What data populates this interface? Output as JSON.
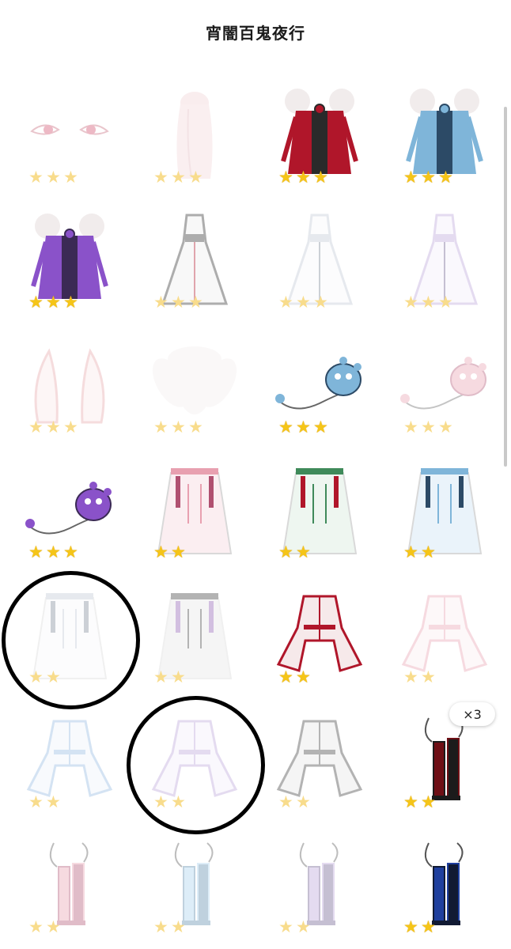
{
  "header": {
    "title": "宵闇百鬼夜行"
  },
  "items": [
    {
      "icon": "eyes-icon",
      "stars": 3,
      "owned": false
    },
    {
      "icon": "long-hair-icon",
      "stars": 3,
      "owned": false
    },
    {
      "icon": "red-kimono-hair-icon",
      "stars": 3,
      "owned": true
    },
    {
      "icon": "blue-kimono-hair-icon",
      "stars": 3,
      "owned": true
    },
    {
      "icon": "purple-kimono-hair-icon",
      "stars": 3,
      "owned": true
    },
    {
      "icon": "black-dress-icon",
      "stars": 3,
      "owned": false
    },
    {
      "icon": "white-blue-dress-icon",
      "stars": 3,
      "owned": false
    },
    {
      "icon": "lilac-dress-icon",
      "stars": 3,
      "owned": false
    },
    {
      "icon": "fox-ears-icon",
      "stars": 3,
      "owned": false
    },
    {
      "icon": "fox-tails-icon",
      "stars": 3,
      "owned": false
    },
    {
      "icon": "blue-ghost-mask-icon",
      "stars": 3,
      "owned": true
    },
    {
      "icon": "pink-ghost-mask-icon",
      "stars": 3,
      "owned": false
    },
    {
      "icon": "purple-ghost-mask-icon",
      "stars": 3,
      "owned": true
    },
    {
      "icon": "pink-veil-cape-icon",
      "stars": 2,
      "owned": true
    },
    {
      "icon": "green-veil-cape-icon",
      "stars": 2,
      "owned": true
    },
    {
      "icon": "blue-veil-cape-icon",
      "stars": 2,
      "owned": true
    },
    {
      "icon": "white-veil-cape-icon",
      "stars": 2,
      "owned": false,
      "circled": true
    },
    {
      "icon": "dark-veil-cape-icon",
      "stars": 2,
      "owned": false
    },
    {
      "icon": "red-white-jacket-icon",
      "stars": 2,
      "owned": true
    },
    {
      "icon": "pink-white-jacket-icon",
      "stars": 2,
      "owned": false
    },
    {
      "icon": "blue-white-jacket-icon",
      "stars": 2,
      "owned": false
    },
    {
      "icon": "lilac-white-jacket-icon",
      "stars": 2,
      "owned": false,
      "circled": true
    },
    {
      "icon": "dark-jacket-icon",
      "stars": 2,
      "owned": false
    },
    {
      "icon": "red-black-boots-icon",
      "stars": 2,
      "owned": true,
      "badge": "×3"
    },
    {
      "icon": "pink-boots-icon",
      "stars": 2,
      "owned": false
    },
    {
      "icon": "light-blue-boots-icon",
      "stars": 2,
      "owned": false
    },
    {
      "icon": "lilac-boots-icon",
      "stars": 2,
      "owned": false
    },
    {
      "icon": "blue-black-boots-icon",
      "stars": 2,
      "owned": true
    }
  ],
  "colors": {
    "star": "#f5c518",
    "star_faded": "#f8dc8c",
    "circle_annotation": "#000000"
  }
}
